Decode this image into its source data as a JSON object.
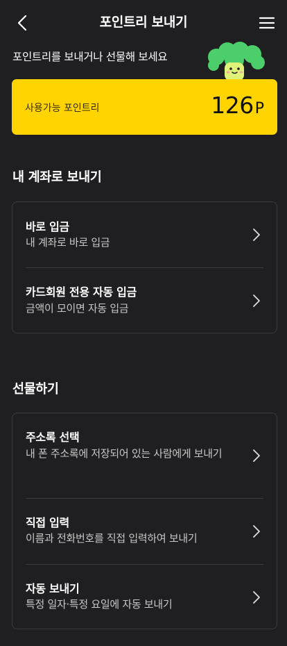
{
  "header": {
    "title": "포인트리 보내기",
    "back_icon": "chevron-left-icon",
    "menu_icon": "hamburger-menu-icon"
  },
  "intro": "포인트리를 보내거나 선물해 보세요",
  "points": {
    "label": "사용가능 포인트리",
    "amount": "126",
    "unit": "P",
    "card_color": "#ffd400"
  },
  "send_to_account": {
    "title": "내 계좌로 보내기",
    "items": [
      {
        "title": "바로 입금",
        "subtitle": "내 계좌로 바로 입금"
      },
      {
        "title": "카드회원 전용 자동 입금",
        "subtitle": "금액이 모이면 자동 입금"
      }
    ]
  },
  "gift": {
    "title": "선물하기",
    "items": [
      {
        "title": "주소록 선택",
        "subtitle": "내 폰 주소록에 저장되어 있는 사람에게 보내기"
      },
      {
        "title": "직접 입력",
        "subtitle": "이름과 전화번호를 직접 입력하여 보내기"
      },
      {
        "title": "자동 보내기",
        "subtitle": "특정 일자·특정 요일에 자동 보내기"
      }
    ]
  },
  "colors": {
    "background": "#1f1f21",
    "accent_yellow": "#ffd400",
    "mascot_green": "#4ccf6a"
  }
}
